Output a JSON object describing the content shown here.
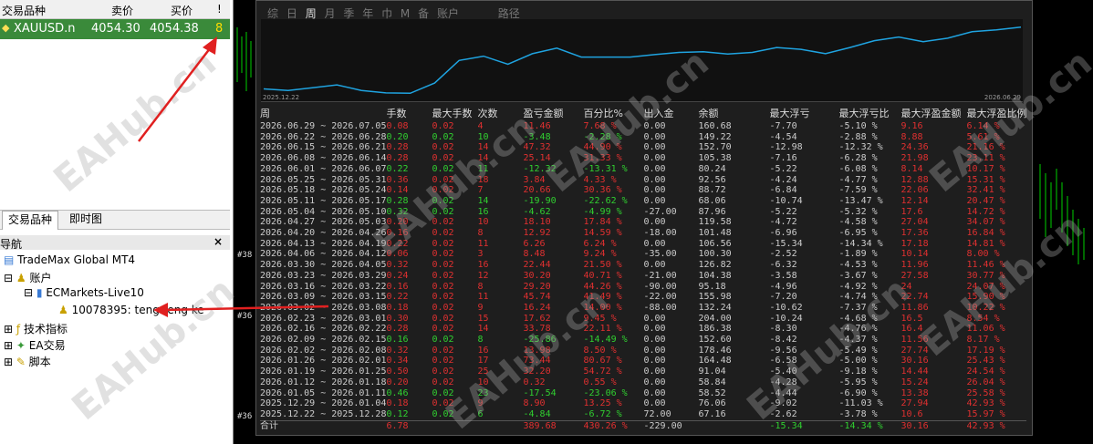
{
  "market_watch": {
    "headers": [
      "交易品种",
      "卖价",
      "买价",
      "!"
    ],
    "row": {
      "symbol": "XAUUSD.n",
      "bid": "4054.30",
      "ask": "4054.38",
      "spread": "8"
    },
    "tabs": [
      "交易品种",
      "即时图"
    ]
  },
  "navigator": {
    "title": "导航",
    "close": "×",
    "items": [
      "TradeMax Global MT4",
      "账户",
      "ECMarkets-Live10",
      "10078395: teng teng ke",
      "技术指标",
      "EA交易",
      "脚本"
    ]
  },
  "report": {
    "tabs": [
      "综",
      "日",
      "周",
      "月",
      "季",
      "年",
      "巾",
      "M",
      "备",
      "账户"
    ],
    "extra_tab": "路径",
    "selected_tab": "周",
    "equity_start_date": "2025.12.22",
    "equity_end_date": "2026.06.29",
    "headers": [
      "周",
      "手数",
      "最大手数",
      "次数",
      "盈亏金额",
      "百分比%",
      "出入金",
      "余额",
      "最大浮亏",
      "最大浮亏比",
      "最大浮盈金额",
      "最大浮盈比例"
    ],
    "rows": [
      [
        "2026.06.29 ~ 2026.07.05",
        "0.08",
        "0.02",
        "4",
        "11.46",
        "7.68 %",
        "0.00",
        "160.68",
        "-7.70",
        "-5.10 %",
        "9.16",
        "6.14 %"
      ],
      [
        "2026.06.22 ~ 2026.06.28",
        "0.20",
        "0.02",
        "10",
        "-3.48",
        "-2.28 %",
        "0.00",
        "149.22",
        "-4.54",
        "-2.88 %",
        "8.88",
        "5.61 %"
      ],
      [
        "2026.06.15 ~ 2026.06.21",
        "0.28",
        "0.02",
        "14",
        "47.32",
        "44.90 %",
        "0.00",
        "152.70",
        "-12.98",
        "-12.32 %",
        "24.36",
        "21.16 %"
      ],
      [
        "2026.06.08 ~ 2026.06.14",
        "0.28",
        "0.02",
        "14",
        "25.14",
        "31.33 %",
        "0.00",
        "105.38",
        "-7.16",
        "-6.28 %",
        "21.98",
        "23.11 %"
      ],
      [
        "2026.06.01 ~ 2026.06.07",
        "0.22",
        "0.02",
        "11",
        "-12.32",
        "-13.31 %",
        "0.00",
        "80.24",
        "-5.22",
        "-6.08 %",
        "8.14",
        "10.17 %"
      ],
      [
        "2026.05.25 ~ 2026.05.31",
        "0.36",
        "0.02",
        "18",
        "3.84",
        "4.33 %",
        "0.00",
        "92.56",
        "-4.24",
        "-4.77 %",
        "12.88",
        "15.31 %"
      ],
      [
        "2026.05.18 ~ 2026.05.24",
        "0.14",
        "0.02",
        "7",
        "20.66",
        "30.36 %",
        "0.00",
        "88.72",
        "-6.84",
        "-7.59 %",
        "22.06",
        "32.41 %"
      ],
      [
        "2026.05.11 ~ 2026.05.17",
        "0.28",
        "0.02",
        "14",
        "-19.90",
        "-22.62 %",
        "0.00",
        "68.06",
        "-10.74",
        "-13.47 %",
        "12.14",
        "20.47 %"
      ],
      [
        "2026.05.04 ~ 2026.05.10",
        "0.32",
        "0.02",
        "16",
        "-4.62",
        "-4.99 %",
        "-27.00",
        "87.96",
        "-5.22",
        "-5.32 %",
        "17.6",
        "14.72 %"
      ],
      [
        "2026.04.27 ~ 2026.05.03",
        "0.20",
        "0.02",
        "10",
        "18.10",
        "17.84 %",
        "0.00",
        "119.58",
        "-4.72",
        "-4.58 %",
        "27.04",
        "34.07 %"
      ],
      [
        "2026.04.20 ~ 2026.04.26",
        "0.16",
        "0.02",
        "8",
        "12.92",
        "14.59 %",
        "-18.00",
        "101.48",
        "-6.96",
        "-6.95 %",
        "17.36",
        "16.84 %"
      ],
      [
        "2026.04.13 ~ 2026.04.19",
        "0.22",
        "0.02",
        "11",
        "6.26",
        "6.24 %",
        "0.00",
        "106.56",
        "-15.34",
        "-14.34 %",
        "17.18",
        "14.81 %"
      ],
      [
        "2026.04.06 ~ 2026.04.12",
        "0.06",
        "0.02",
        "3",
        "8.48",
        "9.24 %",
        "-35.00",
        "100.30",
        "-2.52",
        "-1.89 %",
        "10.14",
        "8.00 %"
      ],
      [
        "2026.03.30 ~ 2026.04.05",
        "0.32",
        "0.02",
        "16",
        "22.44",
        "21.50 %",
        "0.00",
        "126.82",
        "-6.32",
        "-4.53 %",
        "11.96",
        "11.46 %"
      ],
      [
        "2026.03.23 ~ 2026.03.29",
        "0.24",
        "0.02",
        "12",
        "30.20",
        "40.71 %",
        "-21.00",
        "104.38",
        "-3.58",
        "-3.67 %",
        "27.58",
        "30.77 %"
      ],
      [
        "2026.03.16 ~ 2026.03.22",
        "0.16",
        "0.02",
        "8",
        "29.20",
        "44.26 %",
        "-90.00",
        "95.18",
        "-4.96",
        "-4.92 %",
        "24",
        "24.07 %"
      ],
      [
        "2026.03.09 ~ 2026.03.15",
        "0.22",
        "0.02",
        "11",
        "45.74",
        "41.49 %",
        "-22.00",
        "155.98",
        "-7.20",
        "-4.74 %",
        "22.74",
        "15.90 %"
      ],
      [
        "2026.03.02 ~ 2026.03.08",
        "0.18",
        "0.02",
        "9",
        "16.24",
        "14.00 %",
        "-88.00",
        "132.24",
        "-10.62",
        "-7.37 %",
        "11.86",
        "10.22 %"
      ],
      [
        "2026.02.23 ~ 2026.03.01",
        "0.30",
        "0.02",
        "15",
        "17.62",
        "9.45 %",
        "0.00",
        "204.00",
        "-10.24",
        "-4.68 %",
        "16.5",
        "8.54 %"
      ],
      [
        "2026.02.16 ~ 2026.02.22",
        "0.28",
        "0.02",
        "14",
        "33.78",
        "22.11 %",
        "0.00",
        "186.38",
        "-8.30",
        "-4.76 %",
        "16.4",
        "11.06 %"
      ],
      [
        "2026.02.09 ~ 2026.02.15",
        "0.16",
        "0.02",
        "8",
        "-25.86",
        "-14.49 %",
        "0.00",
        "152.60",
        "-8.42",
        "-4.37 %",
        "11.56",
        "8.17 %"
      ],
      [
        "2026.02.02 ~ 2026.02.08",
        "0.32",
        "0.02",
        "16",
        "13.98",
        "8.50 %",
        "0.00",
        "178.46",
        "-9.56",
        "-5.49 %",
        "27.74",
        "17.19 %"
      ],
      [
        "2026.01.26 ~ 2026.02.01",
        "0.34",
        "0.02",
        "17",
        "73.44",
        "80.67 %",
        "0.00",
        "164.48",
        "-6.58",
        "-5.00 %",
        "30.16",
        "25.43 %"
      ],
      [
        "2026.01.19 ~ 2026.01.25",
        "0.50",
        "0.02",
        "25",
        "32.20",
        "54.72 %",
        "0.00",
        "91.04",
        "-5.40",
        "-9.18 %",
        "14.44",
        "24.54 %"
      ],
      [
        "2026.01.12 ~ 2026.01.18",
        "0.20",
        "0.02",
        "10",
        "0.32",
        "0.55 %",
        "0.00",
        "58.84",
        "-4.28",
        "-5.95 %",
        "15.24",
        "26.04 %"
      ],
      [
        "2026.01.05 ~ 2026.01.11",
        "0.46",
        "0.02",
        "23",
        "-17.54",
        "-23.06 %",
        "0.00",
        "58.52",
        "-4.44",
        "-6.90 %",
        "13.38",
        "25.58 %"
      ],
      [
        "2025.12.29 ~ 2026.01.04",
        "0.18",
        "0.02",
        "9",
        "8.90",
        "13.25 %",
        "0.00",
        "76.06",
        "-9.02",
        "-11.03 %",
        "27.94",
        "42.93 %"
      ],
      [
        "2025.12.22 ~ 2025.12.28",
        "0.12",
        "0.02",
        "6",
        "-4.84",
        "-6.72 %",
        "72.00",
        "67.16",
        "-2.62",
        "-3.78 %",
        "10.6",
        "15.97 %"
      ]
    ],
    "total": [
      "合计",
      "6.78",
      "",
      "",
      "389.68",
      "430.26 %",
      "-229.00",
      "",
      "-15.34",
      "-14.34 %",
      "30.16",
      "42.93 %"
    ]
  },
  "equity_series": [
    72,
    67,
    76,
    85,
    67,
    59,
    58,
    91,
    164,
    178,
    152,
    186,
    204,
    175,
    175,
    175,
    183,
    190,
    192,
    185,
    190,
    206,
    200,
    186,
    206,
    228,
    240,
    225,
    236,
    257,
    263,
    272
  ],
  "watermark": "EAHub.cn",
  "chart_labels": [
    "#38",
    "#36",
    "#36"
  ],
  "colors": {
    "profit": "#e03030",
    "loss": "#30d030",
    "equity_line": "#1fa3e0",
    "mw_row": "#3a8a3a"
  }
}
